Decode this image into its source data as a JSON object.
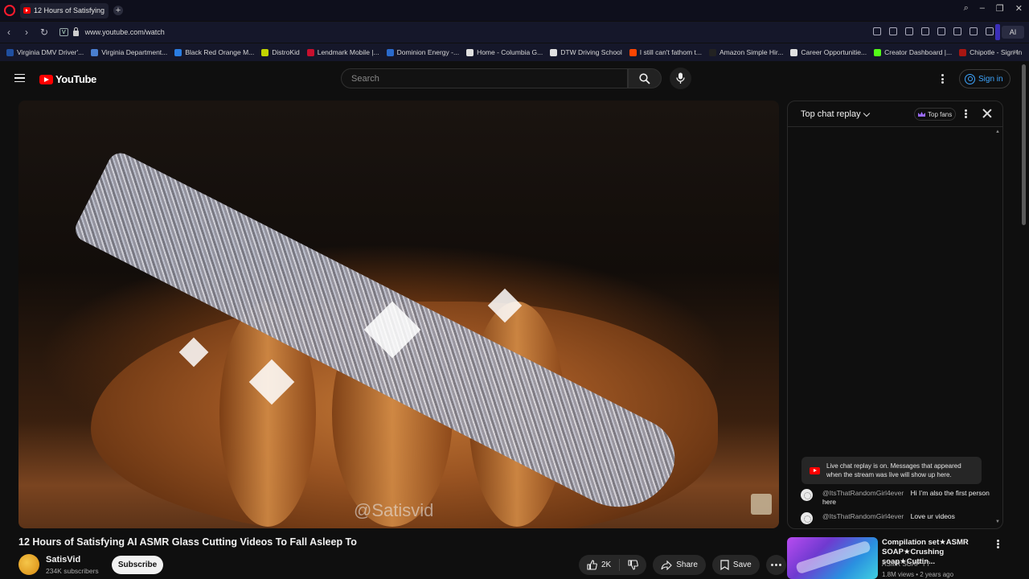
{
  "browser": {
    "tab_title": "12 Hours of Satisfying",
    "new_tab_label": "+",
    "url": "www.youtube.com/watch",
    "vpn_label": "V",
    "ai_label": "AI",
    "bookmarks": [
      {
        "label": "Virginia DMV Driver'...",
        "color": "#1f4fa0"
      },
      {
        "label": "Virginia Department...",
        "color": "#4a7fd0"
      },
      {
        "label": "Black Red Orange M...",
        "color": "#2a7de1"
      },
      {
        "label": "DistroKid",
        "color": "#c2d400"
      },
      {
        "label": "Lendmark Mobile |...",
        "color": "#c8102e"
      },
      {
        "label": "Dominion Energy -...",
        "color": "#2a6acb"
      },
      {
        "label": "Home - Columbia G...",
        "color": "#e0e0e0"
      },
      {
        "label": "DTW Driving School",
        "color": "#e0e0e0"
      },
      {
        "label": "I still can't fathom t...",
        "color": "#ff4500"
      },
      {
        "label": "Amazon Simple Hir...",
        "color": "#222222"
      },
      {
        "label": "Career Opportunitie...",
        "color": "#e0e0e0"
      },
      {
        "label": "Creator Dashboard |...",
        "color": "#53fc18"
      },
      {
        "label": "Chipotle - Sign In",
        "color": "#a81612"
      }
    ]
  },
  "header": {
    "logo_text": "YouTube",
    "search_placeholder": "Search",
    "signin_label": "Sign in"
  },
  "video": {
    "watermark": "@Satisvid",
    "title": "12 Hours of Satisfying AI ASMR Glass Cutting Videos To Fall Asleep To",
    "channel_name": "SatisVid",
    "channel_subs": "234K subscribers",
    "subscribe_label": "Subscribe",
    "like_count": "2K",
    "share_label": "Share",
    "save_label": "Save"
  },
  "chat": {
    "title": "Top chat replay",
    "top_fans_label": "Top fans",
    "replay_notice": "Live chat replay is on. Messages that appeared when the stream was live will show up here.",
    "messages": [
      {
        "author": "@ItsThatRandomGirl4ever",
        "text": "Hi I’m also the first person here"
      },
      {
        "author": "@ItsThatRandomGirl4ever",
        "text": "Love ur videos"
      }
    ]
  },
  "related": {
    "title": "Compilation set★ASMR SOAP★Crushing soap★Cuttin...",
    "channel": "ASMR SOAP YT",
    "meta": "1.8M views • 2 years ago"
  },
  "colors": {
    "youtube_red": "#ff0000",
    "signin_blue": "#3ea6ff",
    "opera_red": "#ff1b2d"
  }
}
